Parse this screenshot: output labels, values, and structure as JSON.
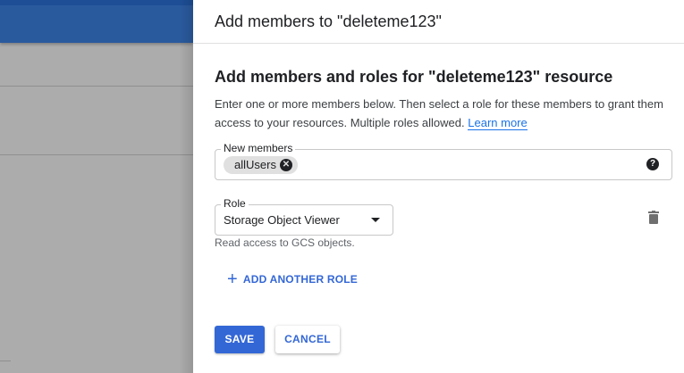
{
  "dialog": {
    "title": "Add members to \"deleteme123\"",
    "heading": "Add members and roles for \"deleteme123\" resource",
    "description": "Enter one or more members below. Then select a role for these members to grant them access to your resources. Multiple roles allowed.",
    "learn_more": "Learn more",
    "members": {
      "label": "New members",
      "chips": [
        "allUsers"
      ],
      "remove_icon": "close-circle-icon",
      "help_icon": "help-icon"
    },
    "role": {
      "label": "Role",
      "value": "Storage Object Viewer",
      "hint": "Read access to GCS objects.",
      "delete_icon": "trash-icon"
    },
    "add_role": "ADD ANOTHER ROLE",
    "save": "SAVE",
    "cancel": "CANCEL"
  },
  "colors": {
    "primary": "#3367d6",
    "backdrop": "#acacac"
  }
}
